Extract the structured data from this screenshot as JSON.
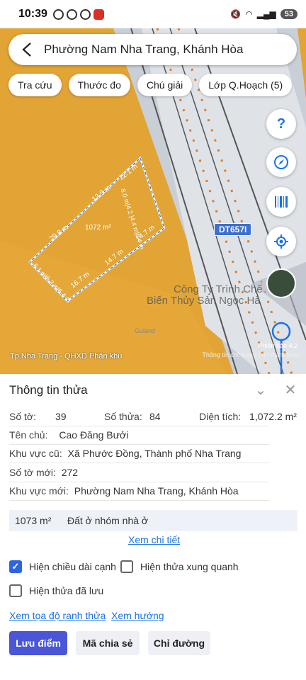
{
  "status": {
    "time": "10:39",
    "battery": "53"
  },
  "search": {
    "title": "Phường Nam Nha Trang, Khánh Hòa"
  },
  "chips": [
    "Tra cứu",
    "Thước đo",
    "Chú giải",
    "Lớp Q.Hoạch (5)"
  ],
  "map": {
    "road_label": "DT657I",
    "company_label_1": "Công Ty Trình Chế",
    "company_label_2": "Biến Thủy Sản Ngọc Hà",
    "parcel_area": "1072 m²",
    "edges": {
      "top": "12.1 m",
      "top2": "13.9 m",
      "left_top": "29.8 m",
      "right": "8.0 m|4.2 |4.4 m|8.4 m",
      "right2": "14.7 m",
      "bottom": "14.7 m",
      "bottom2": "16.7 m",
      "left": "6.1 m|6.2 m|6.4 m"
    },
    "bottom_left_label": "Tp.Nha Trang - QHXD Phân khu",
    "bottom_right_label": "Thông tin chỉ mang tính tham khảo",
    "version_label": "Phiên bản 4.2",
    "brand_watermark": "Guland"
  },
  "panel": {
    "title": "Thông tin thửa",
    "so_to_label": "Số tờ:",
    "so_to": "39",
    "so_thua_label": "Số thửa:",
    "so_thua": "84",
    "dien_tich_label": "Diện tích:",
    "dien_tich": "1,072.2 m²",
    "ten_chu_label": "Tên chủ:",
    "ten_chu": "Cao Đăng Bưởi",
    "khu_vuc_cu_label": "Khu vực cũ:",
    "khu_vuc_cu": "Xã Phước Đồng, Thành phố Nha Trang",
    "so_to_moi_label": "Số tờ mới:",
    "so_to_moi": "272",
    "khu_vuc_moi_label": "Khu vực mới:",
    "khu_vuc_moi": "Phường Nam Nha Trang, Khánh Hòa",
    "landuse_area": "1073 m²",
    "landuse_type": "Đất ở nhóm nhà ở",
    "detail_link": "Xem chi tiết",
    "cb_edge_length": "Hiện chiều dài cạnh",
    "cb_surrounding": "Hiện thửa xung quanh",
    "cb_saved": "Hiện thửa đã lưu",
    "link_coords": "Xem tọa độ ranh thửa",
    "link_direction": "Xem hướng",
    "btn_save": "Lưu điểm",
    "btn_share": "Mã chia sẻ",
    "btn_directions": "Chỉ đường"
  },
  "colors": {
    "accent": "#4a55d8",
    "link": "#1a73e8",
    "map_land": "#e2a434"
  }
}
